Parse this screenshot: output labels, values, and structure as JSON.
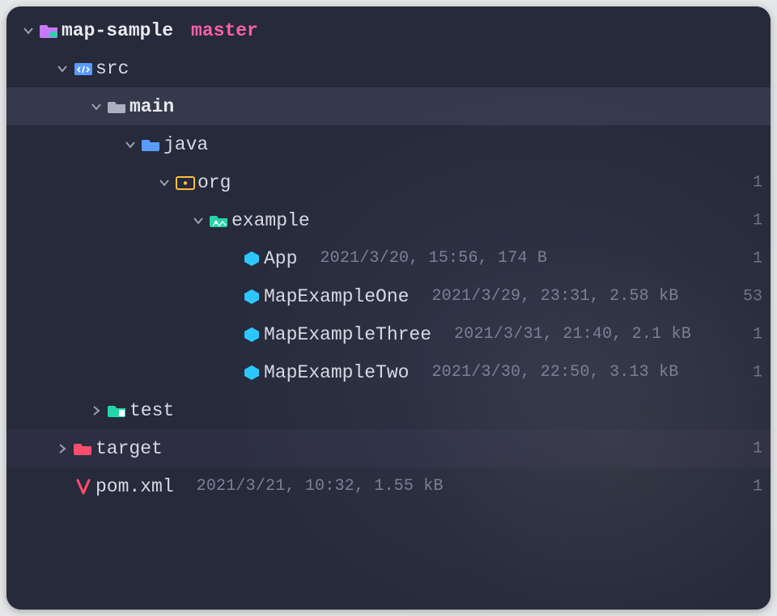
{
  "project": {
    "name": "map-sample",
    "branch": "master"
  },
  "tree": {
    "src": {
      "label": "src"
    },
    "main": {
      "label": "main"
    },
    "java": {
      "label": "java"
    },
    "org": {
      "label": "org"
    },
    "example": {
      "label": "example"
    },
    "files": {
      "app": {
        "name": "App",
        "meta": "2021/3/20, 15:56, 174 B",
        "trail": "1"
      },
      "one": {
        "name": "MapExampleOne",
        "meta": "2021/3/29, 23:31, 2.58 kB",
        "trail": "53"
      },
      "three": {
        "name": "MapExampleThree",
        "meta": "2021/3/31, 21:40, 2.1 kB",
        "trail": "1"
      },
      "two": {
        "name": "MapExampleTwo",
        "meta": "2021/3/30, 22:50, 3.13 kB",
        "trail": "1"
      }
    },
    "test": {
      "label": "test"
    },
    "target": {
      "label": "target",
      "trail": "1"
    },
    "pom": {
      "name": "pom.xml",
      "meta": "2021/3/21, 10:32, 1.55 kB",
      "trail": "1"
    }
  },
  "gutter": {
    "g1": "1",
    "g2": "1",
    "g3": "1"
  }
}
